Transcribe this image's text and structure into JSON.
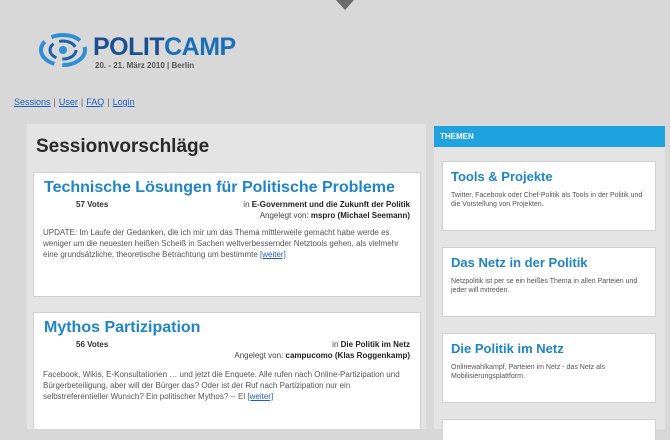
{
  "header": {
    "logo": {
      "word_part1": "POLIT",
      "word_part2": "CAMP",
      "date_line": "20. - 21. März 2010 | Berlin"
    },
    "nav": [
      "Sessions",
      "User",
      "FAQ",
      "Login"
    ]
  },
  "main": {
    "title": "Sessionvorschläge",
    "sessions": [
      {
        "title": "Technische Lösungen für Politische Probleme",
        "votes": "57 Votes",
        "category_prefix": "in",
        "category": "E-Government und die Zukunft der Politik",
        "author_prefix": "Angelegt von:",
        "author": "mspro (Michael Seemann)",
        "text": "UPDATE: Im Laufe der Gedanken, die ich mir um das Thema mittlerweile gemacht habe werde es weniger um die neuesten heißen Scheiß in Sachen weltverbessernder Netztools gehen, als vielmehr eine grundsätzliche, theoretische Betrachtung um bestimmte",
        "more": "[weiter]"
      },
      {
        "title": "Mythos Partizipation",
        "votes": "56 Votes",
        "category_prefix": "in",
        "category": "Die Politik im Netz",
        "author_prefix": "Angelegt von:",
        "author": "campucomo (Klas Roggenkamp)",
        "text": "Facebook, Wikis, E-Konsultationen … und jetzt die Enquete. Alle rufen nach Online-Partizipation und Bürgerbeteiligung, aber will der Bürger das? Oder ist der Ruf nach Partizipation nur ein selbstreferentieller Wunsch? Ein politischer Mythos? -- El",
        "more": "[weiter]"
      }
    ]
  },
  "sidebar": {
    "header": "THEMEN",
    "topics": [
      {
        "title": "Tools & Projekte",
        "text": "Twitter, Facebook oder Chef-Politik als Tools in der Politik und die Vorstellung von Projekten."
      },
      {
        "title": "Das Netz in der Politik",
        "text": "Netzpolitik ist per se ein heißes Thema in allen Parteien und jeder will mitreden."
      },
      {
        "title": "Die Politik im Netz",
        "text": "Onlinewahlkampf, Parteien im Netz - das Netz als Mobilisierungsplattform."
      }
    ]
  },
  "colors": {
    "accent": "#1ea3df",
    "title_blue": "#1e85c8",
    "link": "#1f5fbd"
  }
}
